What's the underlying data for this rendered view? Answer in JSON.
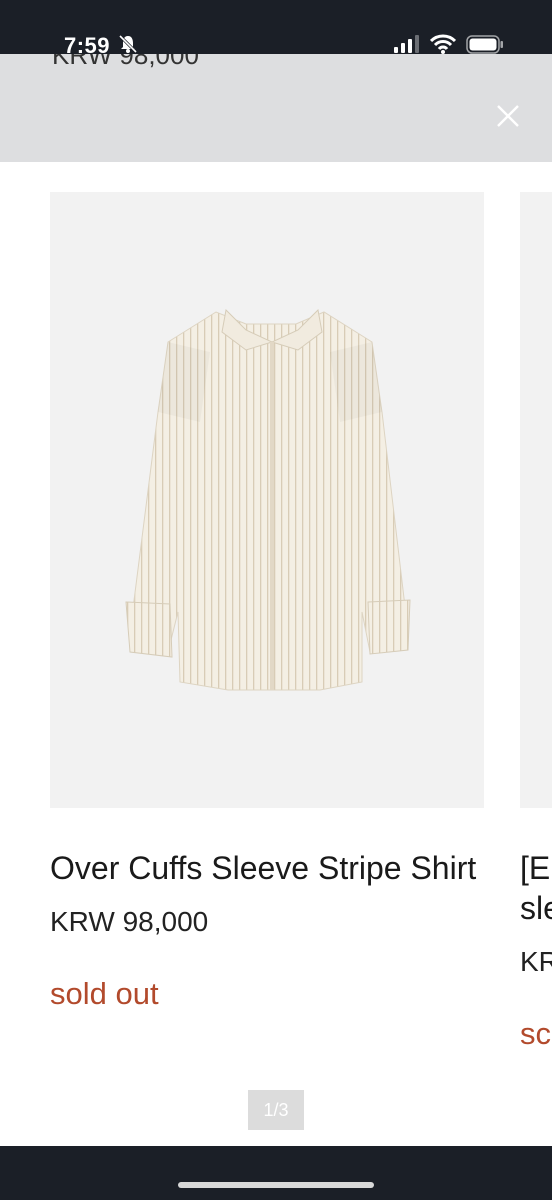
{
  "status_bar": {
    "time": "7:59",
    "icons": [
      "bell-slash-icon",
      "signal-icon",
      "wifi-icon",
      "battery-icon"
    ]
  },
  "header": {
    "peek_text": "KRW 98,000",
    "close_icon": "close-icon"
  },
  "product": {
    "title": "Over Cuffs Sleeve Stripe Shirt",
    "price": "KRW 98,000",
    "status": "sold out"
  },
  "next_product": {
    "title_fragment": "[E",
    "title_fragment2": "sle",
    "price_fragment": "KR",
    "status_fragment": "sc"
  },
  "pagination": {
    "label": "1/3"
  },
  "colors": {
    "sold_out": "#b24a2c",
    "header_bg": "#dcdddf",
    "status_bar_bg": "#1b1f27"
  }
}
